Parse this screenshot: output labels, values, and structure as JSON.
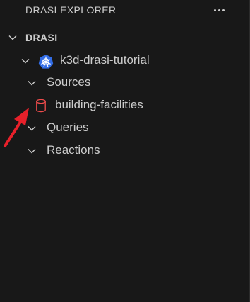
{
  "panel": {
    "title": "DRASI EXPLORER",
    "more_actions_icon": "ellipsis-icon"
  },
  "tree": {
    "root": {
      "label": "DRASI",
      "expanded": true,
      "icon": "chevron-down-icon"
    },
    "cluster": {
      "label": "k3d-drasi-tutorial",
      "expanded": true,
      "icon": "kubernetes-icon"
    },
    "sources": {
      "label": "Sources",
      "expanded": true,
      "items": [
        {
          "label": "building-facilities",
          "icon": "database-icon",
          "icon_color": "#f14c4c"
        }
      ]
    },
    "queries": {
      "label": "Queries",
      "expanded": false
    },
    "reactions": {
      "label": "Reactions",
      "expanded": false
    }
  },
  "colors": {
    "background": "#181818",
    "text": "#cccccc",
    "kubernetes_blue": "#326ce5",
    "database_red": "#f14c4c",
    "annotation_arrow": "#e8202a"
  },
  "annotation": {
    "type": "arrow",
    "icon": "red-arrow-icon"
  }
}
